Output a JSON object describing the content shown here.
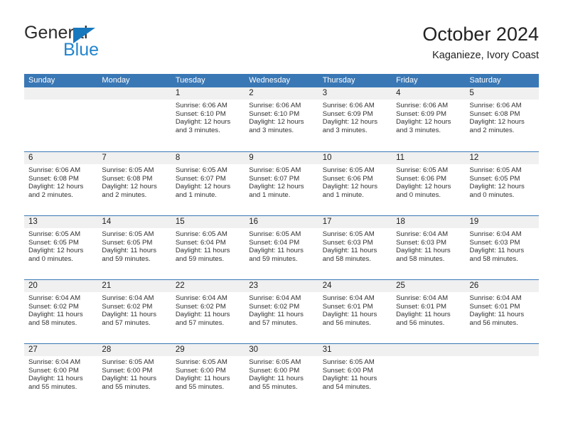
{
  "brand": {
    "name_part1": "General",
    "name_part2": "Blue"
  },
  "header": {
    "title": "October 2024",
    "subtitle": "Kaganieze, Ivory Coast"
  },
  "colors": {
    "header_blue": "#3a78b5",
    "brand_blue": "#2285d0",
    "brand_triangle": "#1878be",
    "daynum_band": "#f0f0f0",
    "text": "#313131"
  },
  "calendar": {
    "weekdays": [
      "Sunday",
      "Monday",
      "Tuesday",
      "Wednesday",
      "Thursday",
      "Friday",
      "Saturday"
    ],
    "weeks": [
      [
        {
          "day": "",
          "lines": []
        },
        {
          "day": "",
          "lines": []
        },
        {
          "day": "1",
          "lines": [
            "Sunrise: 6:06 AM",
            "Sunset: 6:10 PM",
            "Daylight: 12 hours",
            "and 3 minutes."
          ]
        },
        {
          "day": "2",
          "lines": [
            "Sunrise: 6:06 AM",
            "Sunset: 6:10 PM",
            "Daylight: 12 hours",
            "and 3 minutes."
          ]
        },
        {
          "day": "3",
          "lines": [
            "Sunrise: 6:06 AM",
            "Sunset: 6:09 PM",
            "Daylight: 12 hours",
            "and 3 minutes."
          ]
        },
        {
          "day": "4",
          "lines": [
            "Sunrise: 6:06 AM",
            "Sunset: 6:09 PM",
            "Daylight: 12 hours",
            "and 3 minutes."
          ]
        },
        {
          "day": "5",
          "lines": [
            "Sunrise: 6:06 AM",
            "Sunset: 6:08 PM",
            "Daylight: 12 hours",
            "and 2 minutes."
          ]
        }
      ],
      [
        {
          "day": "6",
          "lines": [
            "Sunrise: 6:06 AM",
            "Sunset: 6:08 PM",
            "Daylight: 12 hours",
            "and 2 minutes."
          ]
        },
        {
          "day": "7",
          "lines": [
            "Sunrise: 6:05 AM",
            "Sunset: 6:08 PM",
            "Daylight: 12 hours",
            "and 2 minutes."
          ]
        },
        {
          "day": "8",
          "lines": [
            "Sunrise: 6:05 AM",
            "Sunset: 6:07 PM",
            "Daylight: 12 hours",
            "and 1 minute."
          ]
        },
        {
          "day": "9",
          "lines": [
            "Sunrise: 6:05 AM",
            "Sunset: 6:07 PM",
            "Daylight: 12 hours",
            "and 1 minute."
          ]
        },
        {
          "day": "10",
          "lines": [
            "Sunrise: 6:05 AM",
            "Sunset: 6:06 PM",
            "Daylight: 12 hours",
            "and 1 minute."
          ]
        },
        {
          "day": "11",
          "lines": [
            "Sunrise: 6:05 AM",
            "Sunset: 6:06 PM",
            "Daylight: 12 hours",
            "and 0 minutes."
          ]
        },
        {
          "day": "12",
          "lines": [
            "Sunrise: 6:05 AM",
            "Sunset: 6:05 PM",
            "Daylight: 12 hours",
            "and 0 minutes."
          ]
        }
      ],
      [
        {
          "day": "13",
          "lines": [
            "Sunrise: 6:05 AM",
            "Sunset: 6:05 PM",
            "Daylight: 12 hours",
            "and 0 minutes."
          ]
        },
        {
          "day": "14",
          "lines": [
            "Sunrise: 6:05 AM",
            "Sunset: 6:05 PM",
            "Daylight: 11 hours",
            "and 59 minutes."
          ]
        },
        {
          "day": "15",
          "lines": [
            "Sunrise: 6:05 AM",
            "Sunset: 6:04 PM",
            "Daylight: 11 hours",
            "and 59 minutes."
          ]
        },
        {
          "day": "16",
          "lines": [
            "Sunrise: 6:05 AM",
            "Sunset: 6:04 PM",
            "Daylight: 11 hours",
            "and 59 minutes."
          ]
        },
        {
          "day": "17",
          "lines": [
            "Sunrise: 6:05 AM",
            "Sunset: 6:03 PM",
            "Daylight: 11 hours",
            "and 58 minutes."
          ]
        },
        {
          "day": "18",
          "lines": [
            "Sunrise: 6:04 AM",
            "Sunset: 6:03 PM",
            "Daylight: 11 hours",
            "and 58 minutes."
          ]
        },
        {
          "day": "19",
          "lines": [
            "Sunrise: 6:04 AM",
            "Sunset: 6:03 PM",
            "Daylight: 11 hours",
            "and 58 minutes."
          ]
        }
      ],
      [
        {
          "day": "20",
          "lines": [
            "Sunrise: 6:04 AM",
            "Sunset: 6:02 PM",
            "Daylight: 11 hours",
            "and 58 minutes."
          ]
        },
        {
          "day": "21",
          "lines": [
            "Sunrise: 6:04 AM",
            "Sunset: 6:02 PM",
            "Daylight: 11 hours",
            "and 57 minutes."
          ]
        },
        {
          "day": "22",
          "lines": [
            "Sunrise: 6:04 AM",
            "Sunset: 6:02 PM",
            "Daylight: 11 hours",
            "and 57 minutes."
          ]
        },
        {
          "day": "23",
          "lines": [
            "Sunrise: 6:04 AM",
            "Sunset: 6:02 PM",
            "Daylight: 11 hours",
            "and 57 minutes."
          ]
        },
        {
          "day": "24",
          "lines": [
            "Sunrise: 6:04 AM",
            "Sunset: 6:01 PM",
            "Daylight: 11 hours",
            "and 56 minutes."
          ]
        },
        {
          "day": "25",
          "lines": [
            "Sunrise: 6:04 AM",
            "Sunset: 6:01 PM",
            "Daylight: 11 hours",
            "and 56 minutes."
          ]
        },
        {
          "day": "26",
          "lines": [
            "Sunrise: 6:04 AM",
            "Sunset: 6:01 PM",
            "Daylight: 11 hours",
            "and 56 minutes."
          ]
        }
      ],
      [
        {
          "day": "27",
          "lines": [
            "Sunrise: 6:04 AM",
            "Sunset: 6:00 PM",
            "Daylight: 11 hours",
            "and 55 minutes."
          ]
        },
        {
          "day": "28",
          "lines": [
            "Sunrise: 6:05 AM",
            "Sunset: 6:00 PM",
            "Daylight: 11 hours",
            "and 55 minutes."
          ]
        },
        {
          "day": "29",
          "lines": [
            "Sunrise: 6:05 AM",
            "Sunset: 6:00 PM",
            "Daylight: 11 hours",
            "and 55 minutes."
          ]
        },
        {
          "day": "30",
          "lines": [
            "Sunrise: 6:05 AM",
            "Sunset: 6:00 PM",
            "Daylight: 11 hours",
            "and 55 minutes."
          ]
        },
        {
          "day": "31",
          "lines": [
            "Sunrise: 6:05 AM",
            "Sunset: 6:00 PM",
            "Daylight: 11 hours",
            "and 54 minutes."
          ]
        },
        {
          "day": "",
          "lines": []
        },
        {
          "day": "",
          "lines": []
        }
      ]
    ]
  }
}
